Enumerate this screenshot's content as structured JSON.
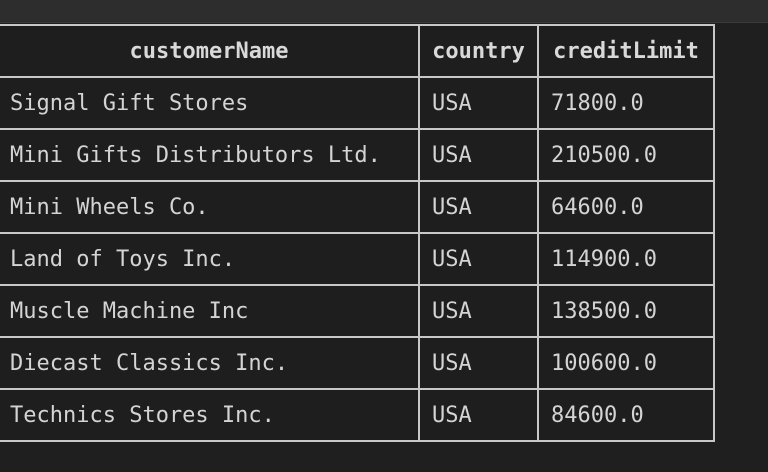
{
  "table": {
    "headers": [
      "customerName",
      "country",
      "creditLimit"
    ],
    "rows": [
      [
        "Signal Gift Stores",
        "USA",
        "71800.0"
      ],
      [
        "Mini Gifts Distributors Ltd.",
        "USA",
        "210500.0"
      ],
      [
        "Mini Wheels Co.",
        "USA",
        "64600.0"
      ],
      [
        "Land of Toys Inc.",
        "USA",
        "114900.0"
      ],
      [
        "Muscle Machine Inc",
        "USA",
        "138500.0"
      ],
      [
        "Diecast Classics Inc.",
        "USA",
        "100600.0"
      ],
      [
        "Technics Stores Inc.",
        "USA",
        "84600.0"
      ]
    ]
  },
  "colors": {
    "background": "#1f1f1f",
    "cell_background": "#1e1e1e",
    "border": "#c8c8c8",
    "text": "#d4d4d4"
  }
}
